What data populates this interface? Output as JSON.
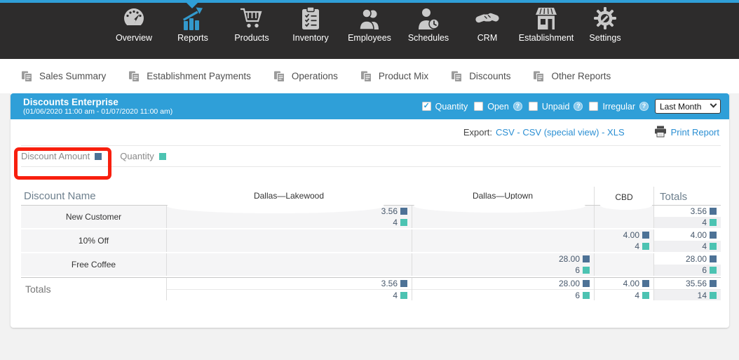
{
  "colors": {
    "accent_blue": "#2f9fd8",
    "link_blue": "#2b8fd3",
    "reports_icon_blue": "#3399cc",
    "discount_amount_square": "#4d7296",
    "quantity_square": "#4cc3b2",
    "annotation_red": "#f81f0e",
    "topnav_bg": "#2d2c2c"
  },
  "topnav": {
    "items": [
      {
        "label": "Overview"
      },
      {
        "label": "Reports"
      },
      {
        "label": "Products"
      },
      {
        "label": "Inventory"
      },
      {
        "label": "Employees"
      },
      {
        "label": "Schedules"
      },
      {
        "label": "CRM"
      },
      {
        "label": "Establishment"
      },
      {
        "label": "Settings"
      }
    ],
    "active": "Reports"
  },
  "subnav": {
    "items": [
      {
        "label": "Sales Summary"
      },
      {
        "label": "Establishment Payments"
      },
      {
        "label": "Operations"
      },
      {
        "label": "Product Mix"
      },
      {
        "label": "Discounts"
      },
      {
        "label": "Other Reports"
      }
    ]
  },
  "report_header": {
    "title": "Discounts Enterprise",
    "date_range": "(01/06/2020 11:00 am - 01/07/2020 11:00 am)",
    "check_glyph": "✓",
    "help_glyph": "?",
    "filters": [
      {
        "label": "Quantity",
        "checked": true,
        "help": false
      },
      {
        "label": "Open",
        "checked": false,
        "help": true
      },
      {
        "label": "Unpaid",
        "checked": false,
        "help": true
      },
      {
        "label": "Irregular",
        "checked": false,
        "help": true
      }
    ],
    "period_select": {
      "value": "Last Month"
    }
  },
  "export_bar": {
    "label": "Export:",
    "links": [
      "CSV",
      "CSV (special view)",
      "XLS"
    ],
    "separator": "-",
    "print_label": "Print Report"
  },
  "legend": {
    "items": [
      {
        "label": "Discount Amount",
        "color": "#4d7296"
      },
      {
        "label": "Quantity",
        "color": "#4cc3b2"
      }
    ]
  },
  "table": {
    "name_header": "Discount Name",
    "columns": [
      "Dallas—Lakewood",
      "Dallas—Uptown",
      "CBD",
      "Totals"
    ],
    "rows": [
      {
        "name": "New Customer",
        "cells": [
          {
            "amount": "3.56",
            "qty": "4"
          },
          {},
          {},
          {
            "amount": "3.56",
            "qty": "4"
          }
        ]
      },
      {
        "name": "10% Off",
        "cells": [
          {},
          {},
          {
            "amount": "4.00",
            "qty": "4"
          },
          {
            "amount": "4.00",
            "qty": "4"
          }
        ]
      },
      {
        "name": "Free Coffee",
        "cells": [
          {},
          {
            "amount": "28.00",
            "qty": "6"
          },
          {},
          {
            "amount": "28.00",
            "qty": "6"
          }
        ]
      }
    ],
    "totals_row": {
      "name": "Totals",
      "cells": [
        {
          "amount": "3.56",
          "qty": "4"
        },
        {
          "amount": "28.00",
          "qty": "6"
        },
        {
          "amount": "4.00",
          "qty": "4"
        },
        {
          "amount": "35.56",
          "qty": "14"
        }
      ]
    }
  }
}
